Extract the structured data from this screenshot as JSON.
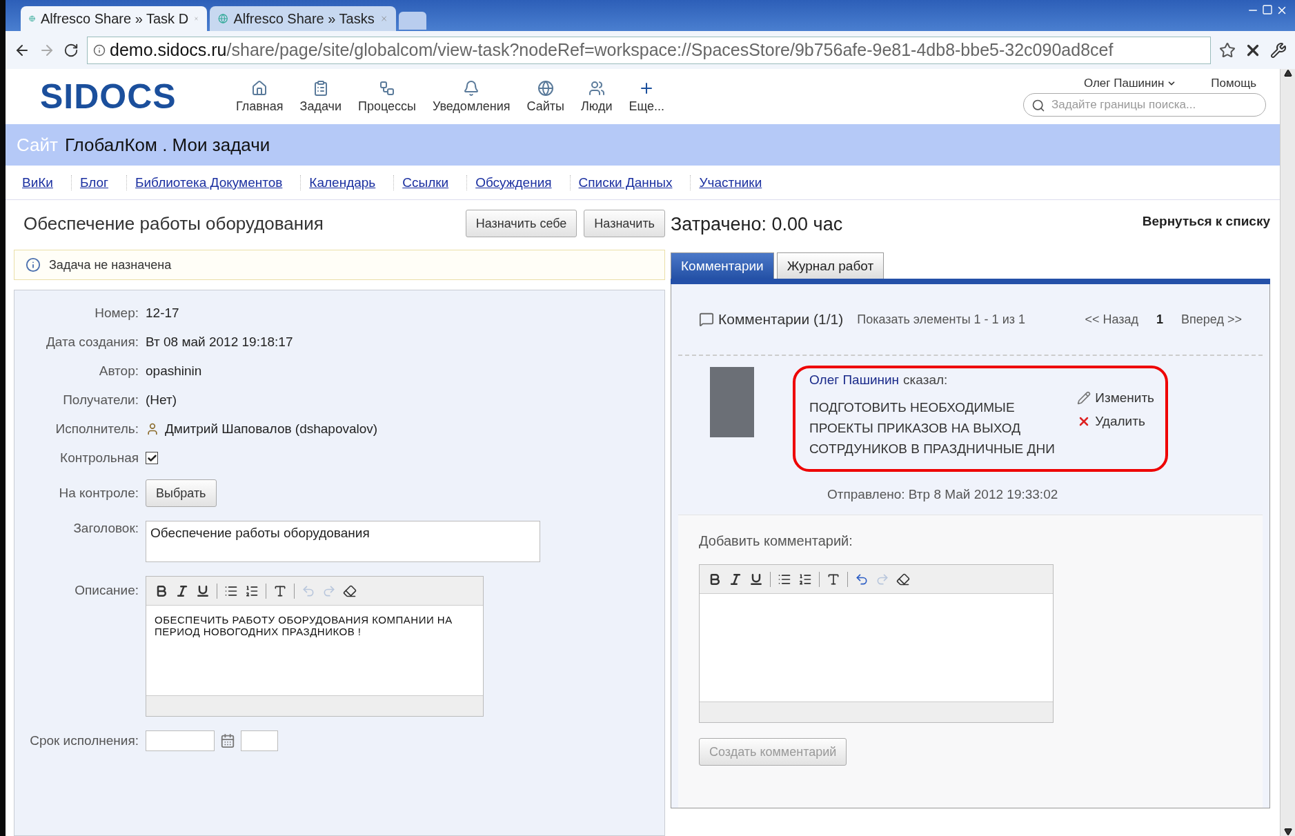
{
  "browser": {
    "tabs": [
      {
        "title": "Alfresco Share » Task D",
        "selected": true
      },
      {
        "title": "Alfresco Share » Tasks",
        "selected": false
      }
    ],
    "url": {
      "host": "demo.sidocs.ru",
      "path": "/share/page/site/globalcom/view-task?nodeRef=workspace://SpacesStore/9b756afe-9e81-4db8-bbe5-32c090ad8cef"
    }
  },
  "header": {
    "logo": "SIDOCS",
    "nav": [
      {
        "label": "Главная",
        "kind": "home"
      },
      {
        "label": "Задачи",
        "kind": "tasks"
      },
      {
        "label": "Процессы",
        "kind": "process"
      },
      {
        "label": "Уведомления",
        "kind": "notify"
      },
      {
        "label": "Сайты",
        "kind": "sites"
      },
      {
        "label": "Люди",
        "kind": "people"
      },
      {
        "label": "Еще...",
        "kind": "more"
      }
    ],
    "user": "Олег Пашинин",
    "help": "Помощь",
    "search": {
      "placeholder": "Задайте границы поиска..."
    }
  },
  "site": {
    "prefix": "Сайт",
    "title": "ГлобалКом . Мои задачи"
  },
  "site_nav": [
    {
      "label": "ВиКи"
    },
    {
      "label": "Блог"
    },
    {
      "label": "Библиотека Документов"
    },
    {
      "label": "Календарь"
    },
    {
      "label": "Ссылки"
    },
    {
      "label": "Обсуждения"
    },
    {
      "label": "Списки Данных"
    },
    {
      "label": "Участники"
    }
  ],
  "task": {
    "title": "Обеспечение работы оборудования",
    "buttons": [
      "Назначить себе",
      "Назначить"
    ],
    "notice": "Задача не назначена",
    "fields": [
      {
        "label": "Номер:",
        "kind": "text",
        "value": "12-17"
      },
      {
        "label": "Дата создания:",
        "kind": "text",
        "value": "Вт 08 май 2012 19:18:17"
      },
      {
        "label": "Автор:",
        "kind": "text",
        "value": "opashinin"
      },
      {
        "label": "Получатели:",
        "kind": "text",
        "value": "(Нет)"
      },
      {
        "label": "Исполнитель:",
        "kind": "person",
        "value": "Дмитрий Шаповалов (dshapovalov)"
      },
      {
        "label": "Контрольная",
        "kind": "checkbox",
        "checked": true
      },
      {
        "label": "На контроле:",
        "kind": "button",
        "value": "Выбрать"
      },
      {
        "label": "Заголовок:",
        "kind": "input",
        "value": "Обеспечение работы оборудования"
      },
      {
        "label": "Описание:",
        "kind": "editor",
        "value": "ОБЕСПЕЧИТЬ РАБОТУ ОБОРУДОВАНИЯ КОМПАНИИ НА ПЕРИОД НОВОГОДНИХ ПРАЗДНИКОВ !"
      },
      {
        "label": "Срок исполнения:",
        "kind": "date"
      }
    ]
  },
  "details": {
    "spent": "Затрачено: 0.00 час",
    "back": "Вернуться к списку",
    "tabs": [
      {
        "label": "Комментарии",
        "selected": true
      },
      {
        "label": "Журнал работ",
        "selected": false
      }
    ],
    "comments": {
      "title": "Комментарии (1/1)",
      "range": "Показать элементы 1 - 1 из 1",
      "prev": "<< Назад",
      "page": "1",
      "next": "Вперед >>",
      "items": [
        {
          "author": "Олег Пашинин",
          "said": "сказал:",
          "text": "ПОДГОТОВИТЬ НЕОБХОДИМЫЕ ПРОЕКТЫ ПРИКАЗОВ НА ВЫХОД СОТРДУНИКОВ В ПРАЗДНИЧНЫЕ ДНИ",
          "actions": [
            {
              "label": "Изменить",
              "kind": "edit"
            },
            {
              "label": "Удалить",
              "kind": "delete"
            }
          ],
          "sent": "Отправлено: Втр 8 Май 2012 19:33:02"
        }
      ]
    },
    "add_label": "Добавить комментарий:",
    "submit": {
      "label": "Создать комментарий",
      "disabled": true
    }
  }
}
